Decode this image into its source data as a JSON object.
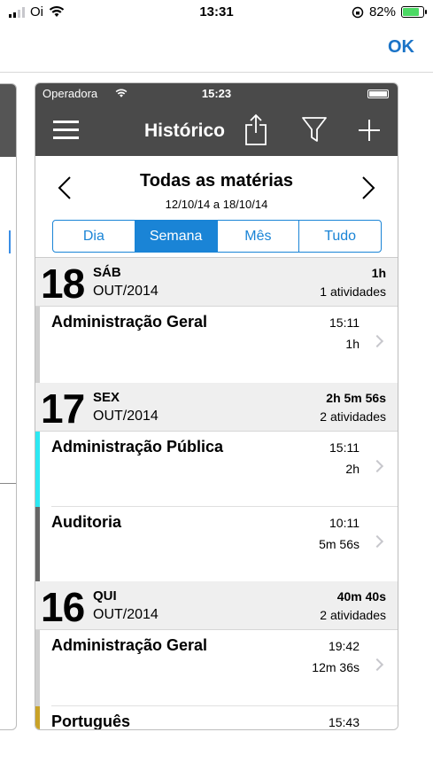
{
  "status": {
    "carrier": "Oi",
    "time": "13:31",
    "battery": "82%"
  },
  "outer": {
    "ok_label": "OK"
  },
  "inner_status": {
    "carrier": "Operadora",
    "time": "15:23"
  },
  "nav": {
    "title": "Histórico",
    "icons": [
      "menu-icon",
      "share-icon",
      "filter-icon",
      "add-icon"
    ]
  },
  "filter": {
    "subject": "Todas as matérias",
    "range": "12/10/14 a 18/10/14",
    "segments": [
      "Dia",
      "Semana",
      "Mês",
      "Tudo"
    ],
    "active_segment": "Semana"
  },
  "days": [
    {
      "day": "18",
      "dow": "SÁB",
      "month": "OUT/2014",
      "total": "1h",
      "count": "1 atividades",
      "entries": [
        {
          "name": "Administração Geral",
          "time": "15:11",
          "duration": "1h",
          "color": "#cfcfcf"
        }
      ]
    },
    {
      "day": "17",
      "dow": "SEX",
      "month": "OUT/2014",
      "total": "2h 5m 56s",
      "count": "2 atividades",
      "entries": [
        {
          "name": "Administração Pública",
          "time": "15:11",
          "duration": "2h",
          "color": "#2de8f2"
        },
        {
          "name": "Auditoria",
          "time": "10:11",
          "duration": "5m 56s",
          "color": "#666666"
        }
      ]
    },
    {
      "day": "16",
      "dow": "QUI",
      "month": "OUT/2014",
      "total": "40m 40s",
      "count": "2 atividades",
      "entries": [
        {
          "name": "Administração Geral",
          "time": "19:42",
          "duration": "12m 36s",
          "color": "#cfcfcf"
        },
        {
          "name": "Português",
          "time": "15:43",
          "duration": "",
          "color": "#c9a227"
        }
      ]
    }
  ]
}
